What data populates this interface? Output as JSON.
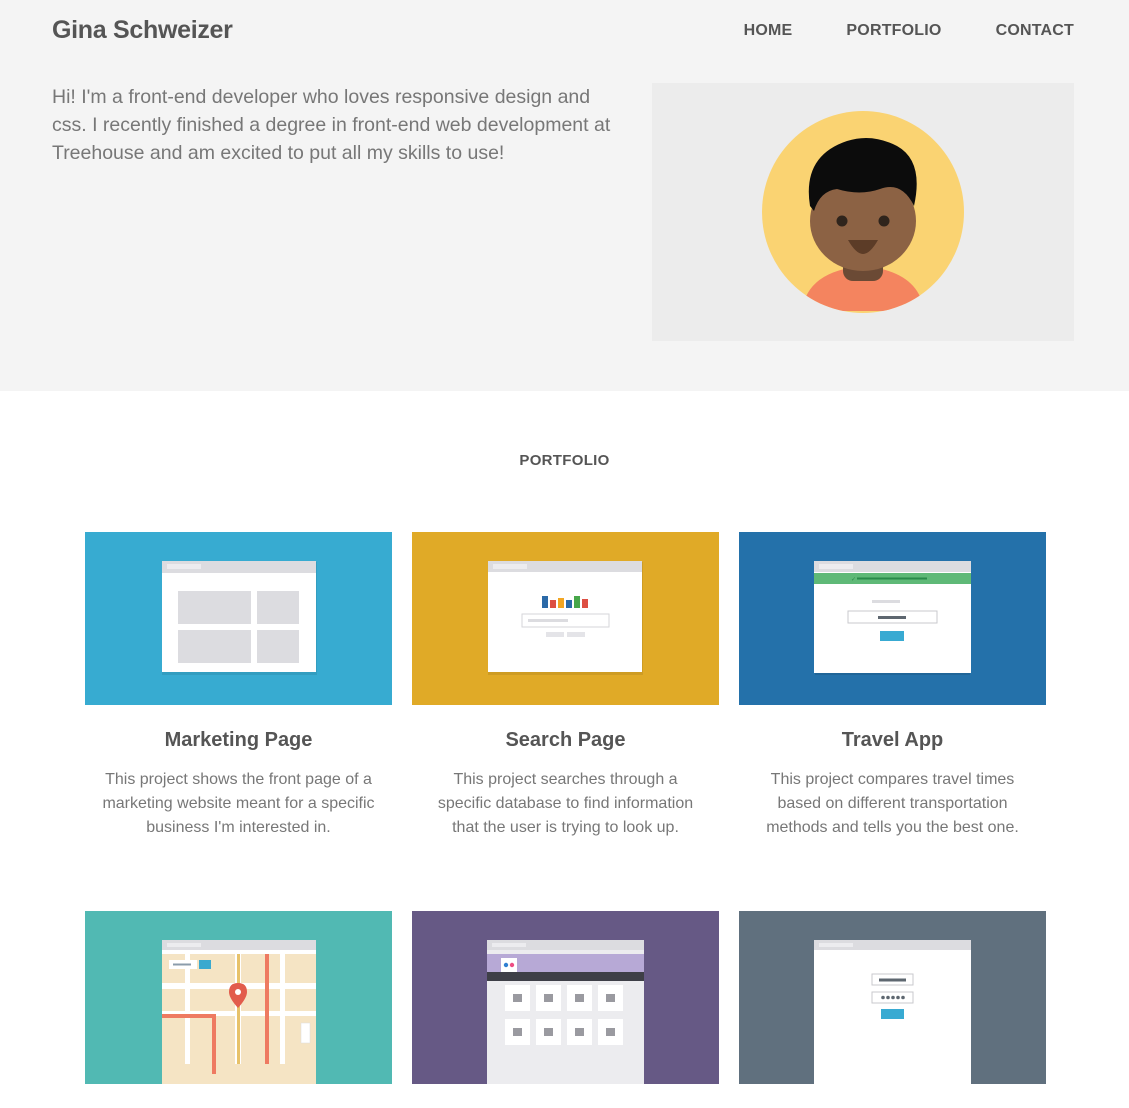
{
  "header": {
    "brand": "Gina Schweizer",
    "nav": [
      "HOME",
      "PORTFOLIO",
      "CONTACT"
    ]
  },
  "hero": {
    "intro": "Hi! I'm a front-end developer who loves responsive design and css. I recently finished a degree in front-end web development at Treehouse and am excited to put all my skills to use!",
    "avatar": "person-avatar-icon"
  },
  "portfolio": {
    "title": "PORTFOLIO",
    "projects": [
      {
        "title": "Marketing Page",
        "description": "This project shows the front page of a marketing website meant for a specific business I'm interested in.",
        "color": "#37abd1",
        "thumbnail": "marketing-page-mockup-icon"
      },
      {
        "title": "Search Page",
        "description": "This project searches through a specific database to find information that the user is trying to look up.",
        "color": "#e0aa27",
        "thumbnail": "search-page-mockup-icon"
      },
      {
        "title": "Travel App",
        "description": "This project compares travel times based on different transportation methods and tells you the best one.",
        "color": "#2471aa",
        "thumbnail": "travel-app-mockup-icon"
      },
      {
        "title": "",
        "description": "",
        "color": "#51b9b3",
        "thumbnail": "map-mockup-icon"
      },
      {
        "title": "",
        "description": "",
        "color": "#665985",
        "thumbnail": "photo-gallery-mockup-icon"
      },
      {
        "title": "",
        "description": "",
        "color": "#60707e",
        "thumbnail": "login-form-mockup-icon"
      }
    ]
  }
}
